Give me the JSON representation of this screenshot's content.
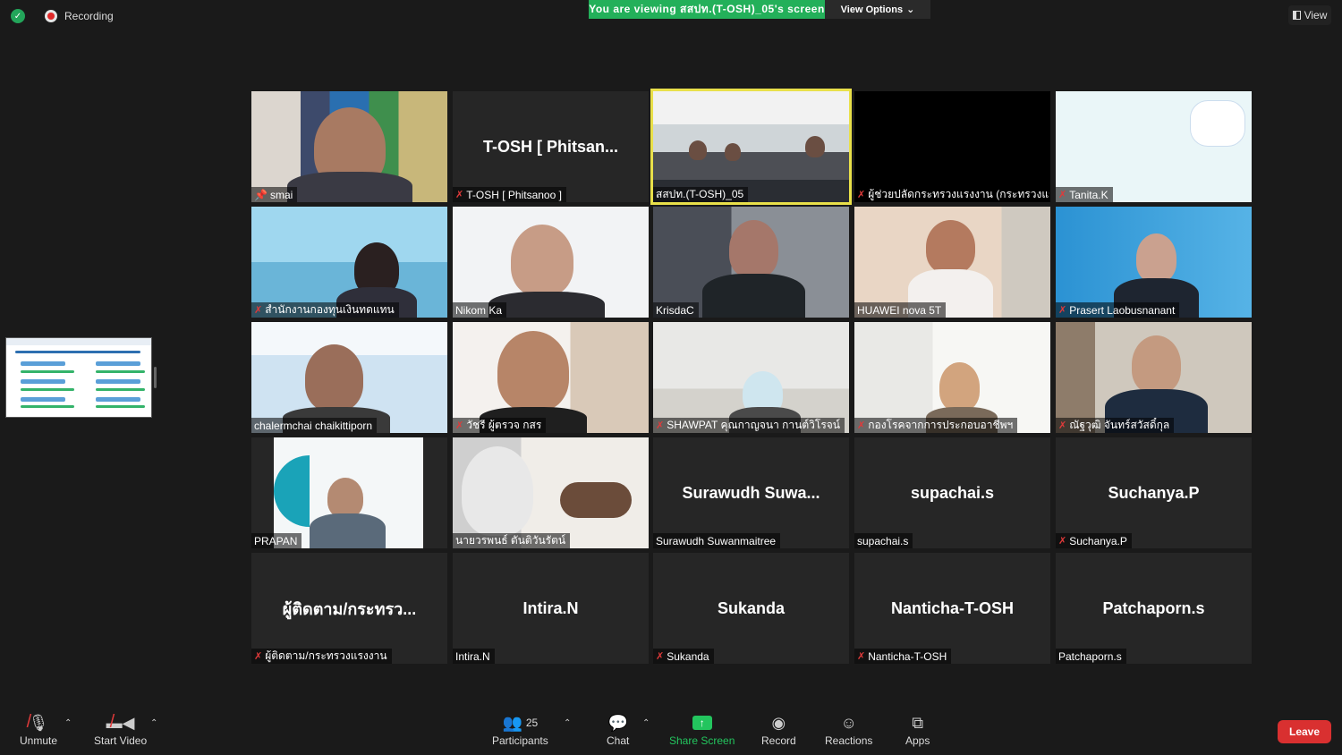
{
  "top": {
    "recording_label": "Recording",
    "viewing_banner": "You are viewing สสปท.(T-OSH)_05's screen",
    "view_options_label": "View Options",
    "view_button_label": "View"
  },
  "tiles": [
    {
      "label": "smai",
      "big_name": "",
      "muted": false,
      "pinned": true
    },
    {
      "label": "T-OSH [ Phitsanoo ]",
      "big_name": "T-OSH [ Phitsan...",
      "muted": true
    },
    {
      "label": "สสปท.(T-OSH)_05",
      "big_name": "",
      "muted": false
    },
    {
      "label": "ผู้ช่วยปลัดกระทรวงแรงงาน (กระทรวงแรง...",
      "big_name": "",
      "muted": true
    },
    {
      "label": "Tanita.K",
      "big_name": "",
      "muted": true
    },
    {
      "label": "สำนักงานกองทุนเงินทดแทน",
      "big_name": "",
      "muted": true
    },
    {
      "label": "Nikom Ka",
      "big_name": "",
      "muted": false
    },
    {
      "label": "KrisdaC",
      "big_name": "",
      "muted": false
    },
    {
      "label": "HUAWEI nova 5T",
      "big_name": "",
      "muted": false
    },
    {
      "label": "Prasert Laobusnanant",
      "big_name": "",
      "muted": true
    },
    {
      "label": "chalermchai chaikittiporn",
      "big_name": "",
      "muted": false
    },
    {
      "label": "วัชรี ผู้ตรวจ กสร",
      "big_name": "",
      "muted": true
    },
    {
      "label": "SHAWPAT คุณกาญจนา กานต์วิโรจน์",
      "big_name": "",
      "muted": true
    },
    {
      "label": "กองโรคจากการประกอบอาชีพฯ",
      "big_name": "",
      "muted": true
    },
    {
      "label": "ณัฐวุฒิ จันทร์สวัสดิ์กุล",
      "big_name": "",
      "muted": true
    },
    {
      "label": "PRAPAN",
      "big_name": "",
      "muted": false
    },
    {
      "label": "นายวรพนธ์ ตันติวันรัตน์",
      "big_name": "",
      "muted": false
    },
    {
      "label": "Surawudh Suwanmaitree",
      "big_name": "Surawudh Suwa...",
      "muted": false
    },
    {
      "label": "supachai.s",
      "big_name": "supachai.s",
      "muted": false
    },
    {
      "label": "Suchanya.P",
      "big_name": "Suchanya.P",
      "muted": true
    },
    {
      "label": "ผู้ติดตาม/กระทรวงแรงงาน",
      "big_name": "ผู้ติดตาม/กระทรว...",
      "muted": true
    },
    {
      "label": "Intira.N",
      "big_name": "Intira.N",
      "muted": false
    },
    {
      "label": "Sukanda",
      "big_name": "Sukanda",
      "muted": true
    },
    {
      "label": "Nanticha-T-OSH",
      "big_name": "Nanticha-T-OSH",
      "muted": true
    },
    {
      "label": "Patchaporn.s",
      "big_name": "Patchaporn.s",
      "muted": false
    }
  ],
  "toolbar": {
    "unmute": "Unmute",
    "start_video": "Start Video",
    "participants": "Participants",
    "participants_count": "25",
    "chat": "Chat",
    "share_screen": "Share Screen",
    "record": "Record",
    "reactions": "Reactions",
    "apps": "Apps",
    "leave": "Leave"
  },
  "colors": {
    "banner_green": "#23b05a",
    "active_speaker": "#e9e04a",
    "leave_red": "#d93030",
    "share_green": "#23c55e"
  }
}
